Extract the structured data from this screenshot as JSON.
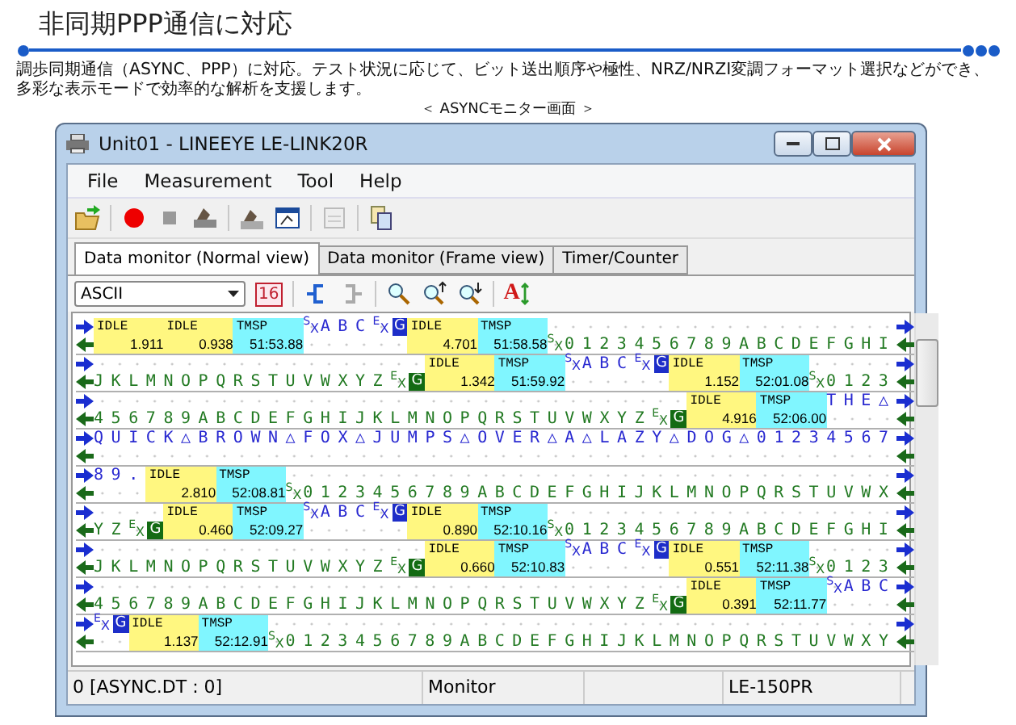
{
  "page": {
    "title": "非同期PPP通信に対応",
    "description": "調歩同期通信（ASYNC、PPP）に対応。テスト状況に応じて、ビット送出順序や極性、NRZ/NRZI変調フォーマット選択などができ、多彩な表示モードで効率的な解析を支援します。",
    "caption": "＜ ASYNCモニター画面 ＞"
  },
  "window": {
    "title": "Unit01 - LINEEYE LE-LINK20R"
  },
  "menu": [
    "File",
    "Measurement",
    "Tool",
    "Help"
  ],
  "tabs": [
    {
      "label": "Data monitor (Normal view)",
      "selected": true
    },
    {
      "label": "Data monitor (Frame view)",
      "selected": false
    },
    {
      "label": "Timer/Counter",
      "selected": false
    }
  ],
  "view_toolbar": {
    "display_select": "ASCII",
    "hex_label": "16",
    "font_label": "A"
  },
  "monitor": {
    "lines": [
      {
        "stream": [
          {
            "kind": "idle",
            "label": "IDLE",
            "value": "1.911"
          },
          {
            "kind": "idle",
            "label": "IDLE",
            "value": "0.938"
          },
          {
            "kind": "tmsp",
            "label": "TMSP",
            "value": "51:53.88"
          },
          {
            "kind": "start",
            "received": false,
            "text": "$^{S}$$_{X}$"
          },
          {
            "kind": "text",
            "received": false,
            "text": "ABC"
          },
          {
            "kind": "end",
            "received": false,
            "text": "$^{E}$$_{X}$"
          },
          {
            "kind": "code",
            "received": false,
            "text": "G"
          },
          {
            "kind": "idle",
            "label": "IDLE",
            "value": "4.701"
          },
          {
            "kind": "tmsp",
            "label": "TMSP",
            "value": "51:58.58"
          },
          {
            "kind": "start",
            "received": true,
            "text": "$^{S}$$_{X}$"
          },
          {
            "kind": "text",
            "received": true,
            "text": "0123456789ABCDEFGHI"
          }
        ]
      },
      {
        "stream": [
          {
            "kind": "text",
            "received": true,
            "text": "JKLMNOPQRSTUVWXYZ"
          },
          {
            "kind": "end",
            "received": true,
            "text": "$^{E}$$_{X}$"
          },
          {
            "kind": "code",
            "received": true,
            "text": "G"
          },
          {
            "kind": "idle",
            "label": "IDLE",
            "value": "1.342"
          },
          {
            "kind": "tmsp",
            "label": "TMSP",
            "value": "51:59.92"
          },
          {
            "kind": "start",
            "received": false,
            "text": "$^{S}$$_{X}$"
          },
          {
            "kind": "text",
            "received": false,
            "text": "ABC"
          },
          {
            "kind": "end",
            "received": false,
            "text": "$^{E}$$_{X}$"
          },
          {
            "kind": "code",
            "received": false,
            "text": "G"
          },
          {
            "kind": "idle",
            "label": "IDLE",
            "value": "1.152"
          },
          {
            "kind": "tmsp",
            "label": "TMSP",
            "value": "52:01.08"
          },
          {
            "kind": "start",
            "received": true,
            "text": "$^{S}$$_{X}$"
          },
          {
            "kind": "text",
            "received": true,
            "text": "0123"
          }
        ]
      },
      {
        "stream": [
          {
            "kind": "text",
            "received": true,
            "text": "456789ABCDEFGHIJKLMNOPQRSTUVWXYZ"
          },
          {
            "kind": "end",
            "received": true,
            "text": "$^{E}$$_{X}$"
          },
          {
            "kind": "code",
            "received": true,
            "text": "G"
          },
          {
            "kind": "idle",
            "label": "IDLE",
            "value": "4.916"
          },
          {
            "kind": "tmsp",
            "label": "TMSP",
            "value": "52:06.00"
          },
          {
            "kind": "text",
            "received": false,
            "text": "THE△"
          }
        ]
      },
      {
        "stream": [
          {
            "kind": "text",
            "received": false,
            "text": "QUICK△BROWN△FOX△JUMPS△OVER△A△LAZY△DOG△01234567"
          }
        ]
      },
      {
        "stream": [
          {
            "kind": "text",
            "received": false,
            "text": "89."
          },
          {
            "kind": "idle",
            "label": "IDLE",
            "value": "2.810"
          },
          {
            "kind": "tmsp",
            "label": "TMSP",
            "value": "52:08.81"
          },
          {
            "kind": "start",
            "received": true,
            "text": "$^{S}$$_{X}$"
          },
          {
            "kind": "text",
            "received": true,
            "text": "0123456789ABCDEFGHIJKLMNOPQRSTUVWX"
          }
        ]
      },
      {
        "stream": [
          {
            "kind": "text",
            "received": true,
            "text": "YZ"
          },
          {
            "kind": "end",
            "received": true,
            "text": "$^{E}$$_{X}$"
          },
          {
            "kind": "code",
            "received": true,
            "text": "G"
          },
          {
            "kind": "idle",
            "label": "IDLE",
            "value": "0.460"
          },
          {
            "kind": "tmsp",
            "label": "TMSP",
            "value": "52:09.27"
          },
          {
            "kind": "start",
            "received": false,
            "text": "$^{S}$$_{X}$"
          },
          {
            "kind": "text",
            "received": false,
            "text": "ABC"
          },
          {
            "kind": "end",
            "received": false,
            "text": "$^{E}$$_{X}$"
          },
          {
            "kind": "code",
            "received": false,
            "text": "G"
          },
          {
            "kind": "idle",
            "label": "IDLE",
            "value": "0.890"
          },
          {
            "kind": "tmsp",
            "label": "TMSP",
            "value": "52:10.16"
          },
          {
            "kind": "start",
            "received": true,
            "text": "$^{S}$$_{X}$"
          },
          {
            "kind": "text",
            "received": true,
            "text": "0123456789ABCDEFGHI"
          }
        ]
      },
      {
        "stream": [
          {
            "kind": "text",
            "received": true,
            "text": "JKLMNOPQRSTUVWXYZ"
          },
          {
            "kind": "end",
            "received": true,
            "text": "$^{E}$$_{X}$"
          },
          {
            "kind": "code",
            "received": true,
            "text": "G"
          },
          {
            "kind": "idle",
            "label": "IDLE",
            "value": "0.660"
          },
          {
            "kind": "tmsp",
            "label": "TMSP",
            "value": "52:10.83"
          },
          {
            "kind": "start",
            "received": false,
            "text": "$^{S}$$_{X}$"
          },
          {
            "kind": "text",
            "received": false,
            "text": "ABC"
          },
          {
            "kind": "end",
            "received": false,
            "text": "$^{E}$$_{X}$"
          },
          {
            "kind": "code",
            "received": false,
            "text": "G"
          },
          {
            "kind": "idle",
            "label": "IDLE",
            "value": "0.551"
          },
          {
            "kind": "tmsp",
            "label": "TMSP",
            "value": "52:11.38"
          },
          {
            "kind": "start",
            "received": true,
            "text": "$^{S}$$_{X}$"
          },
          {
            "kind": "text",
            "received": true,
            "text": "0123"
          }
        ]
      },
      {
        "stream": [
          {
            "kind": "text",
            "received": true,
            "text": "456789ABCDEFGHIJKLMNOPQRSTUVWXYZ"
          },
          {
            "kind": "end",
            "received": true,
            "text": "$^{E}$$_{X}$"
          },
          {
            "kind": "code",
            "received": true,
            "text": "G"
          },
          {
            "kind": "idle",
            "label": "IDLE",
            "value": "0.391"
          },
          {
            "kind": "tmsp",
            "label": "TMSP",
            "value": "52:11.77"
          },
          {
            "kind": "start",
            "received": false,
            "text": "$^{S}$$_{X}$"
          },
          {
            "kind": "text",
            "received": false,
            "text": "ABC"
          }
        ]
      },
      {
        "stream": [
          {
            "kind": "end",
            "received": false,
            "text": "$^{E}$$_{X}$"
          },
          {
            "kind": "code",
            "received": false,
            "text": "G"
          },
          {
            "kind": "idle",
            "label": "IDLE",
            "value": "1.137"
          },
          {
            "kind": "tmsp",
            "label": "TMSP",
            "value": "52:12.91"
          },
          {
            "kind": "start",
            "received": true,
            "text": "$^{S}$$_{X}$"
          },
          {
            "kind": "text",
            "received": true,
            "text": "0123456789ABCDEFGHIJKLMNOPQRSTUVWXY"
          }
        ]
      }
    ]
  },
  "status_bar": [
    "0 [ASYNC.DT : 0]",
    "Monitor",
    "LE-150PR"
  ]
}
